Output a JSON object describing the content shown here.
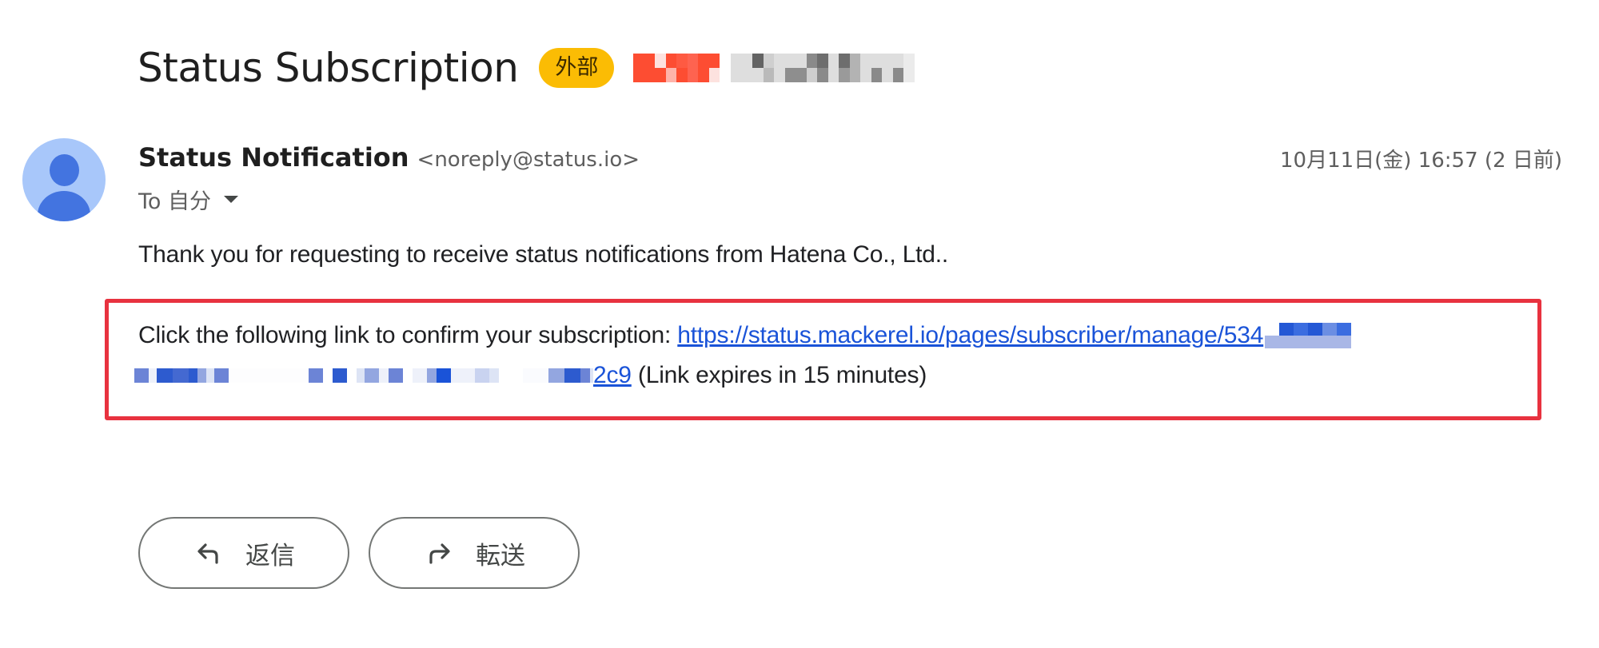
{
  "email": {
    "subject": "Status Subscription",
    "label_badge": "外部",
    "sender": {
      "name": "Status Notification",
      "email": "<noreply@status.io>"
    },
    "recipient": "To 自分",
    "timestamp": "10月11日(金) 16:57 (2 日前)",
    "body": {
      "intro": "Thank you for requesting to receive status notifications from Hatena Co., Ltd..",
      "confirm_prefix": "Click the following link to confirm your subscription: ",
      "link_visible_start": "https://status.mackerel.io/pages/subscriber/manage/534",
      "link_visible_end": "2c9",
      "expiry_note": " (Link expires in 15 minutes)"
    }
  },
  "actions": {
    "reply_label": "返信",
    "forward_label": "転送"
  },
  "icons": {
    "avatar": "person-avatar-icon",
    "recipient_details": "caret-down-icon",
    "reply": "reply-arrow-icon",
    "forward": "forward-arrow-icon"
  },
  "colors": {
    "badge": "#fbbc04",
    "link": "#1a53d8",
    "highlight_border": "#e8323f",
    "avatar_bg": "#a8c7fa",
    "avatar_fg": "#4374e0"
  }
}
